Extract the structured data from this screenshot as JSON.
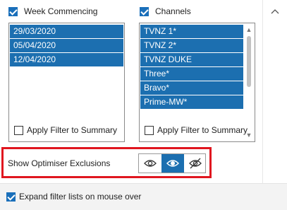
{
  "week_panel": {
    "header_label": "Week Commencing",
    "header_checked": true,
    "items": [
      "29/03/2020",
      "05/04/2020",
      "12/04/2020"
    ],
    "apply_label": "Apply Filter to Summary",
    "apply_checked": false
  },
  "channels_panel": {
    "header_label": "Channels",
    "header_checked": true,
    "items": [
      "TVNZ 1*",
      "TVNZ 2*",
      "TVNZ DUKE",
      "Three*",
      "Bravo*",
      "Prime-MW*"
    ],
    "apply_label": "Apply Filter to Summary",
    "apply_checked": false
  },
  "optimiser": {
    "label": "Show Optimiser Exclusions",
    "options": [
      "eye-outline-icon",
      "eye-filled-icon",
      "eye-off-icon"
    ],
    "selected_index": 1
  },
  "footer": {
    "expand_label": "Expand filter lists on mouse over",
    "expand_checked": true
  },
  "colors": {
    "selection": "#1c6fb0",
    "highlight_border": "#e0161f"
  }
}
